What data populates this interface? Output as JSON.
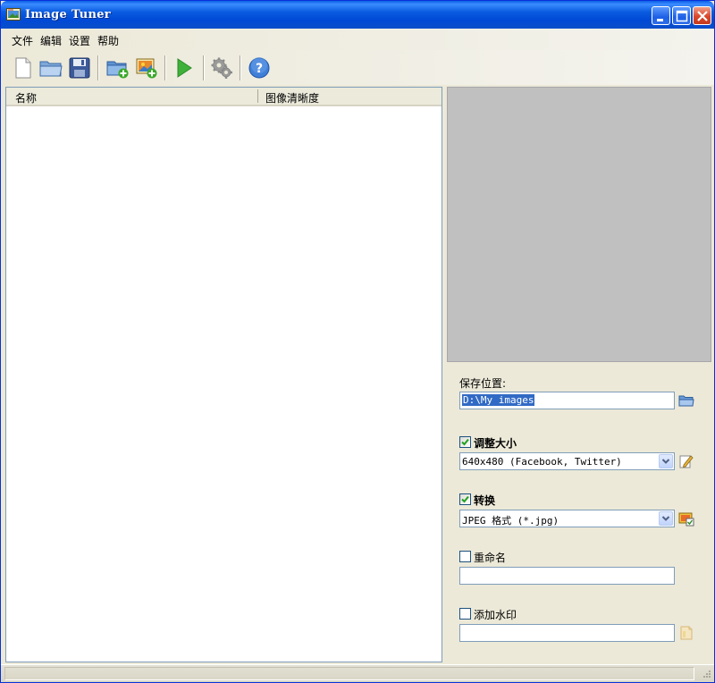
{
  "window": {
    "title": "Image Tuner"
  },
  "menu": [
    "文件",
    "编辑",
    "设置",
    "帮助"
  ],
  "toolbar": {
    "icons": [
      "new-file-icon",
      "open-folder-icon",
      "save-icon",
      "add-folder-icon",
      "add-image-icon",
      "play-icon",
      "settings-gears-icon",
      "help-icon"
    ]
  },
  "list": {
    "columns": [
      "名称",
      "图像清晰度"
    ],
    "rows": []
  },
  "settings": {
    "save_location": {
      "label": "保存位置:",
      "value": "D:\\My images"
    },
    "resize": {
      "label": "调整大小",
      "checked": true,
      "value": "640x480  (Facebook, Twitter)"
    },
    "convert": {
      "label": "转换",
      "checked": true,
      "value": "JPEG 格式 (*.jpg)"
    },
    "rename": {
      "label": "重命名",
      "checked": false,
      "value": ""
    },
    "watermark": {
      "label": "添加水印",
      "checked": false,
      "value": ""
    }
  },
  "colors": {
    "titlebar": "#0a5be0",
    "preview_bg": "#c0c0c0",
    "selection": "#316ac5"
  }
}
